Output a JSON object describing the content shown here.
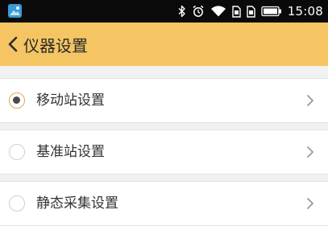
{
  "status_bar": {
    "time": "15:08",
    "icons": [
      "app-icon",
      "bluetooth-icon",
      "alarm-icon",
      "wifi-icon",
      "sim-card-icon",
      "sim-card-icon",
      "battery-icon"
    ]
  },
  "header": {
    "title": "仪器设置",
    "back_icon": "chevron-left-icon",
    "background": "#f4c562"
  },
  "settings": {
    "items": [
      {
        "label": "移动站设置",
        "selected": true
      },
      {
        "label": "基准站设置",
        "selected": false
      },
      {
        "label": "静态采集设置",
        "selected": false
      }
    ]
  }
}
